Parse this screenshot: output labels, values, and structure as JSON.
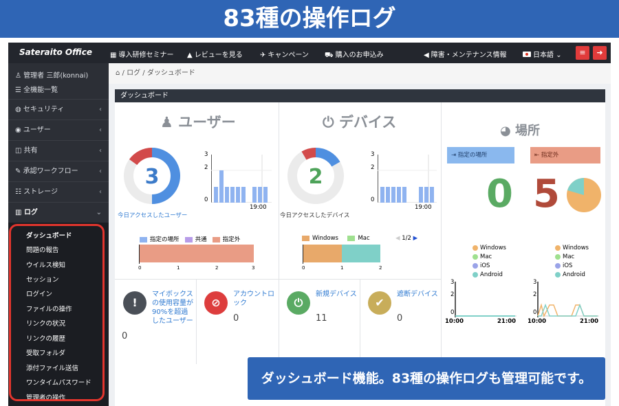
{
  "banner": {
    "title": "83種の操作ログ"
  },
  "topbar": {
    "logo": "Sateraito Office",
    "nav": [
      "導入研修セミナー",
      "レビューを見る",
      "キャンペーン",
      "購入のお申込み"
    ],
    "maintenance": "障害・メンテナンス情報",
    "language": "日本語"
  },
  "sidebar": {
    "user": "管理者 三郎(konnai)",
    "all_features": "全機能一覧",
    "items": [
      {
        "label": "セキュリティ"
      },
      {
        "label": "ユーザー"
      },
      {
        "label": "共有"
      },
      {
        "label": "承認ワークフロー"
      },
      {
        "label": "ストレージ"
      },
      {
        "label": "ログ"
      }
    ],
    "sub_items": [
      "ダッシュボード",
      "問題の報告",
      "ウイルス検知",
      "セッション",
      "ログイン",
      "ファイルの操作",
      "リンクの状況",
      "リンクの履歴",
      "受取フォルダ",
      "添付ファイル送信",
      "ワンタイムパスワード",
      "管理者の操作"
    ]
  },
  "breadcrumb": {
    "sep": "/",
    "log": "ログ",
    "current": "ダッシュボード"
  },
  "panel": {
    "title": "ダッシュボード"
  },
  "users": {
    "title": "ユーザー",
    "count": "3",
    "link": "今日アクセスしたユーザー",
    "chart_time": "19:00",
    "y_top": "3",
    "y_mid": "2",
    "y_min": "0",
    "legend": [
      "指定の場所",
      "共通",
      "指定外"
    ],
    "xticks": [
      "0",
      "1",
      "2",
      "3"
    ]
  },
  "devices": {
    "title": "デバイス",
    "count": "2",
    "link": "今日アクセスしたデバイス",
    "chart_time": "19:00",
    "y_top": "3",
    "y_mid": "2",
    "y_min": "0",
    "legend": [
      "Windows",
      "Mac"
    ],
    "pager": "1/2",
    "xticks": [
      "0",
      "1",
      "2"
    ]
  },
  "places": {
    "title": "場所",
    "inside_label": "指定の場所",
    "outside_label": "指定外",
    "inside_count": "0",
    "outside_count": "5",
    "os_legend": [
      "Windows",
      "Mac",
      "iOS",
      "Android"
    ],
    "y_top": "3",
    "y_mid": "2",
    "y_min": "0",
    "t_start": "10:00",
    "t_end": "21:00"
  },
  "cards": [
    {
      "label": "マイボックスの使用容量が90%を超過したユーザー",
      "value": "0"
    },
    {
      "label": "アカウントロック",
      "value": "0"
    },
    {
      "label": "新規デバイス",
      "value": "11"
    },
    {
      "label": "遮断デバイス",
      "value": "0"
    }
  ],
  "caption": {
    "text": "ダッシュボード機能。83種の操作ログも管理可能です。"
  },
  "colors": {
    "primary": "#2f65b5",
    "red": "#e13b3b",
    "green": "#5aaa63",
    "blue": "#4f8fe0",
    "orange": "#e8a96a",
    "teal": "#7fd0c8"
  }
}
